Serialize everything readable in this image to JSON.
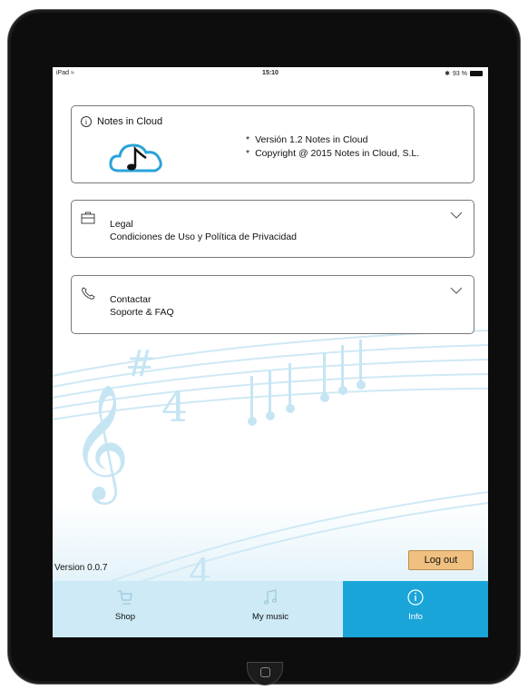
{
  "status": {
    "device": "iPad",
    "time": "15:10",
    "battery": "93 %"
  },
  "about": {
    "title": "Notes in Cloud",
    "lines": [
      "Versión 1.2 Notes in Cloud",
      "Copyright @ 2015 Notes in Cloud, S.L."
    ],
    "bullet": "*"
  },
  "legal": {
    "title": "Legal",
    "subtitle": "Condiciones de Uso y Política de Privacidad"
  },
  "contact": {
    "title": "Contactar",
    "subtitle": "Soporte & FAQ"
  },
  "footer": {
    "version": "Version 0.0.7",
    "logout_label": "Log out"
  },
  "tabs": [
    {
      "label": "Shop",
      "icon": "cart-icon",
      "active": false
    },
    {
      "label": "My music",
      "icon": "music-note-icon",
      "active": false
    },
    {
      "label": "Info",
      "icon": "info-icon",
      "active": true
    }
  ],
  "colors": {
    "accent": "#1aa5d9",
    "tabbar": "#cdeaf6",
    "logout": "#f0c080"
  }
}
